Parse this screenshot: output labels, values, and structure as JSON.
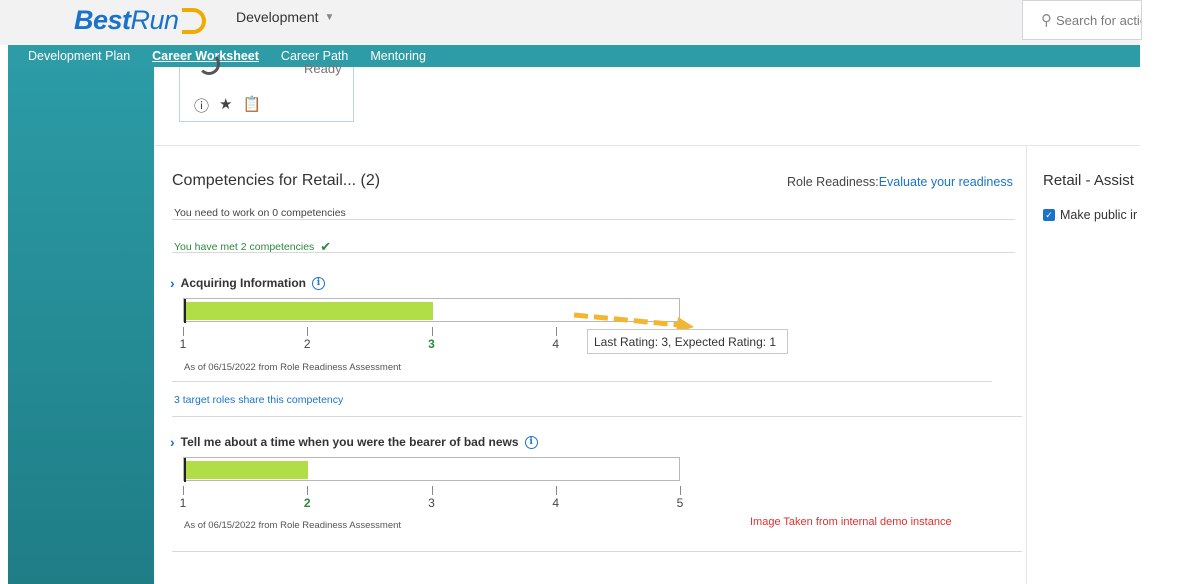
{
  "header": {
    "logo_best": "Best",
    "logo_run": "Run",
    "module_label": "Development",
    "search_placeholder": "Search for actio"
  },
  "nav": {
    "items": [
      {
        "label": "Development Plan"
      },
      {
        "label": "Career Worksheet"
      },
      {
        "label": "Career Path"
      },
      {
        "label": "Mentoring"
      }
    ]
  },
  "job_card": {
    "status": "Ready"
  },
  "competencies": {
    "title": "Competencies for Retail... (2)",
    "role_readiness_label": "Role Readiness:",
    "role_readiness_link": "Evaluate your readiness",
    "need_work": "You need to work on 0 competencies",
    "met": "You have met 2 competencies",
    "items": [
      {
        "name": "Acquiring Information",
        "rating": 3,
        "scale_max_shown": 4,
        "scale_labels": [
          "1",
          "2",
          "3",
          "4"
        ],
        "as_of": "As of 06/15/2022 from Role Readiness Assessment",
        "share": "3 target roles share this competency",
        "tooltip": "Last Rating: 3, Expected Rating: 1"
      },
      {
        "name": "Tell me about a time when you were the bearer of bad news",
        "rating": 2,
        "scale_max_shown": 5,
        "scale_labels": [
          "1",
          "2",
          "3",
          "4",
          "5"
        ],
        "as_of": "As of 06/15/2022 from Role Readiness Assessment"
      }
    ]
  },
  "right_panel": {
    "title": "Retail - Assist",
    "checkbox_label": "Make public ir",
    "checkbox_checked": true
  },
  "watermark": "Image Taken from internal demo instance",
  "colors": {
    "nav_teal": "#2d9ca7",
    "bar_green": "#b1dd46",
    "link_blue": "#1a73c9",
    "met_green": "#2b8a3e"
  }
}
